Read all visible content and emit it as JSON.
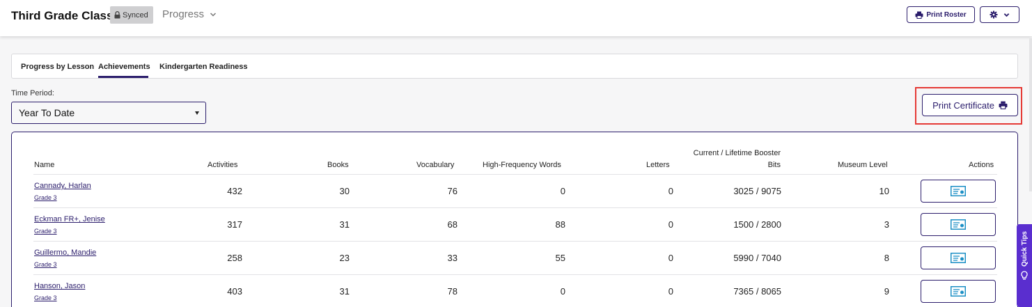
{
  "header": {
    "class_title": "Third Grade Class",
    "synced_label": "Synced",
    "progress_menu_label": "Progress",
    "print_roster_label": "Print Roster"
  },
  "tabs": [
    {
      "label": "Progress by Lesson",
      "active": false
    },
    {
      "label": "Achievements",
      "active": true
    },
    {
      "label": "Kindergarten Readiness",
      "active": false
    }
  ],
  "time_period": {
    "label": "Time Period:",
    "selected": "Year To Date"
  },
  "print_certificate_label": "Print Certificate",
  "table": {
    "headers": {
      "name": "Name",
      "activities": "Activities",
      "books": "Books",
      "vocabulary": "Vocabulary",
      "hfw": "High-Frequency Words",
      "letters": "Letters",
      "booster_line1": "Current / Lifetime Booster",
      "booster_line2": "Bits",
      "museum": "Museum Level",
      "actions": "Actions"
    },
    "rows": [
      {
        "name": "Cannady, Harlan",
        "grade": "Grade 3",
        "activities": "432",
        "books": "30",
        "vocabulary": "76",
        "hfw": "0",
        "letters": "0",
        "booster": "3025 / 9075",
        "museum": "10"
      },
      {
        "name": "Eckman FR+, Jenise",
        "grade": "Grade 3",
        "activities": "317",
        "books": "31",
        "vocabulary": "68",
        "hfw": "88",
        "letters": "0",
        "booster": "1500 / 2800",
        "museum": "3"
      },
      {
        "name": "Guillermo, Mandie",
        "grade": "Grade 3",
        "activities": "258",
        "books": "23",
        "vocabulary": "33",
        "hfw": "55",
        "letters": "0",
        "booster": "5990 / 7040",
        "museum": "8"
      },
      {
        "name": "Hanson, Jason",
        "grade": "Grade 3",
        "activities": "403",
        "books": "31",
        "vocabulary": "78",
        "hfw": "0",
        "letters": "0",
        "booster": "7365 / 8065",
        "museum": "9"
      }
    ]
  },
  "quick_tips_label": "Quick Tips",
  "colors": {
    "accent": "#2a1c6b",
    "highlight": "#e53935",
    "quick_tips": "#5a2ecf",
    "certificate_icon": "#1b8fc5"
  },
  "icons": [
    "lock-icon",
    "chevron-down-icon",
    "printer-icon",
    "gear-icon",
    "caret-down-icon",
    "certificate-icon",
    "lightbulb-icon"
  ]
}
